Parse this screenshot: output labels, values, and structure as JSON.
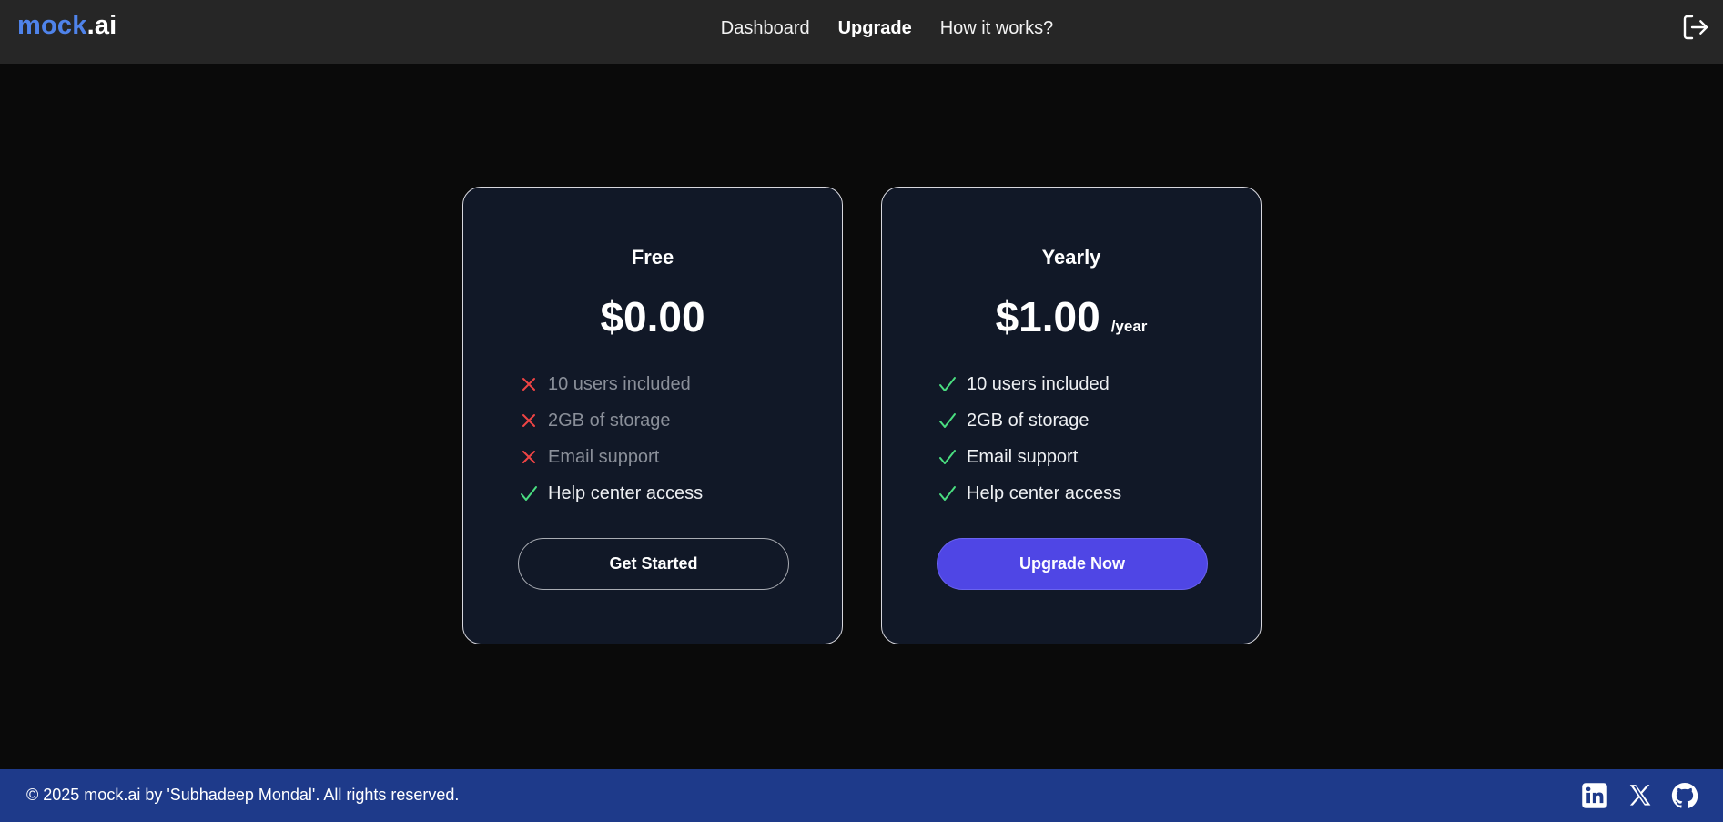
{
  "header": {
    "logo_brand": "mock",
    "logo_suffix": ".ai",
    "nav": {
      "dashboard": "Dashboard",
      "upgrade": "Upgrade",
      "how_it_works": "How it works?"
    },
    "logout_icon": "logout-icon"
  },
  "plans": [
    {
      "name": "Free",
      "price": "$0.00",
      "period": "",
      "features": [
        {
          "label": "10 users included",
          "included": false
        },
        {
          "label": "2GB of storage",
          "included": false
        },
        {
          "label": "Email support",
          "included": false
        },
        {
          "label": "Help center access",
          "included": true
        }
      ],
      "cta": "Get Started"
    },
    {
      "name": "Yearly",
      "price": "$1.00",
      "period": "/year",
      "features": [
        {
          "label": "10 users included",
          "included": true
        },
        {
          "label": "2GB of storage",
          "included": true
        },
        {
          "label": "Email support",
          "included": true
        },
        {
          "label": "Help center access",
          "included": true
        }
      ],
      "cta": "Upgrade Now"
    }
  ],
  "footer": {
    "copyright": "© 2025 mock.ai by 'Subhadeep Mondal'. All rights reserved.",
    "social_icons": [
      "linkedin-icon",
      "x-icon",
      "github-icon"
    ]
  },
  "colors": {
    "header_bg": "#262626",
    "page_bg": "#0a0a0a",
    "card_bg": "#111827",
    "brand": "#4f83ea",
    "accent": "#4f46e5",
    "footer_bg": "#1e3a8a",
    "check": "#4ade80",
    "cross": "#ef4444"
  }
}
